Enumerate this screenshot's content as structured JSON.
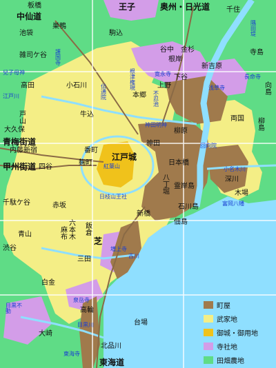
{
  "colors": {
    "field": "#5fdc86",
    "temple": "#d39de8",
    "samurai": "#f4ee86",
    "castle": "#f0c21b",
    "town": "#a07a4c",
    "sea": "#8fdfff",
    "river": "#8fdfff",
    "grid": "#ffffff",
    "label": "#111111",
    "small_label": "#1a3fd0"
  },
  "labels": {
    "oji": "王子",
    "oshu_nikko": "奥州・日光道",
    "senju": "千住",
    "itabashi": "板橋",
    "nakasendo": "中仙道",
    "sugamo": "巣鴨",
    "ikebukuro": "池袋",
    "komagome": "駒込",
    "sumida_tsutsumi": "隅田堤",
    "zoshigaya": "雑司ケ谷",
    "gokokuji": "護国寺",
    "yanaka": "谷中",
    "negishi": "根岸",
    "kanasugi": "金杉",
    "shin_yoshiwara": "新吉原",
    "terajima": "寺島",
    "omoteshin_hikawa": "兒子母神",
    "nezu_gongen": "根津権現",
    "kaneiji": "寛永寺",
    "ueno": "上野",
    "shinobazu": "不忍池",
    "shitaya": "下谷",
    "sensoji": "浅草寺",
    "chomeiji": "長命寺",
    "takata": "高田",
    "koishikawa": "小石川",
    "denzuin": "伝通院",
    "hongo": "本郷",
    "mukojima": "向島",
    "edogawa": "江戸川",
    "ushigome": "牛込",
    "toyama": "戸山",
    "kanda_myojin": "神田明神",
    "yanagibashi": "柳原",
    "ryogoku": "両国",
    "yanagishima": "柳島",
    "okubo": "大久保",
    "ome_kaido": "青梅街道",
    "naito_shinjuku": "内藤新宿",
    "kando": "神田",
    "eko_in": "回向院",
    "koshu_kaido": "甲州街道",
    "yotsuya": "四谷",
    "bancho": "番町",
    "kojimachi": "麹町",
    "edojo": "江戸城",
    "momijiyama": "紅葉山",
    "nihonbashi": "日本橋",
    "onagi_river": "小名木川",
    "fukagawa": "深川",
    "hacchobori": "八丁堀",
    "reiganjima": "霊岸島",
    "kiba": "木場",
    "sendagaya": "千駄ケ谷",
    "sanno": "日枝山王社",
    "akasaka": "赤坂",
    "ishikawajima": "石川島",
    "tomioka_hachiman": "富岡八幡",
    "shimbashi": "新橋",
    "tsukuda": "佃島",
    "aoyama": "青山",
    "roppongi": "六本木",
    "azabu": "麻布",
    "iigura": "飯倉",
    "zojoji": "増上寺",
    "shiba": "芝",
    "shibuya": "渋谷",
    "mita": "三田",
    "furukawa": "古川",
    "shirogane": "白金",
    "sengakuji": "泉岳寺",
    "meguro_fudo": "目黒不動",
    "takanawa": "高輪",
    "meguro_river": "目黒川",
    "daiba": "台場",
    "osaki": "大崎",
    "shinagawa_river": "北品川",
    "tokaiji": "東海寺",
    "tokaido": "東海道"
  },
  "legend": [
    {
      "label": "町屋",
      "color": "#a07a4c"
    },
    {
      "label": "武家地",
      "color": "#f4ee86"
    },
    {
      "label": "御城・御用地",
      "color": "#f0c21b"
    },
    {
      "label": "寺社地",
      "color": "#d39de8"
    },
    {
      "label": "田畑農地",
      "color": "#5fdc86"
    }
  ]
}
